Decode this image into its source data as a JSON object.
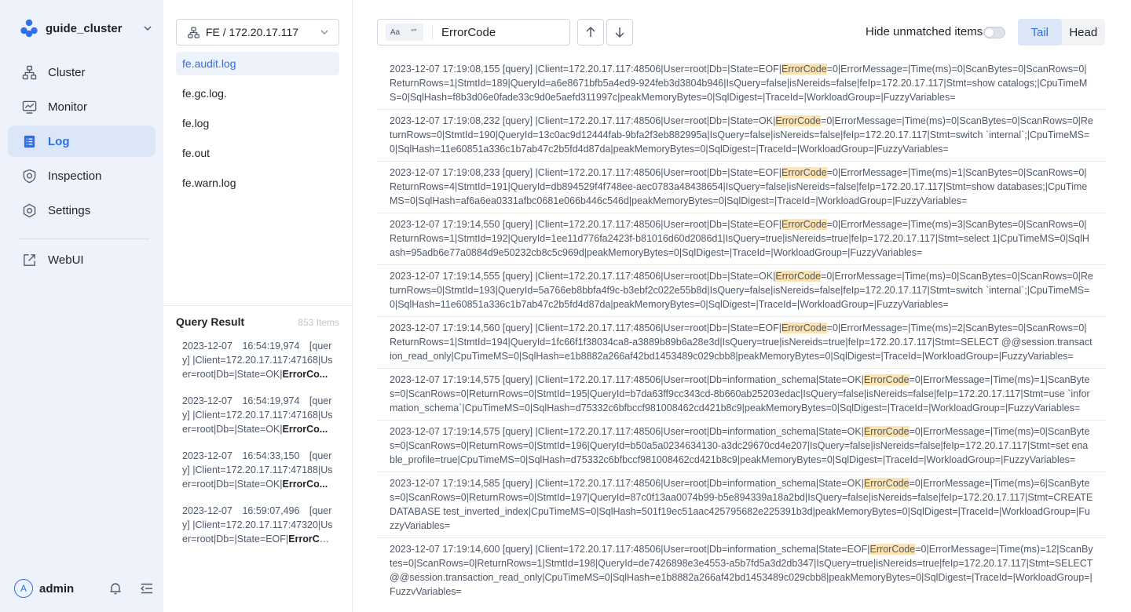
{
  "cluster": {
    "name": "guide_cluster"
  },
  "nav": {
    "items": [
      {
        "label": "Cluster",
        "icon": "cluster-icon"
      },
      {
        "label": "Monitor",
        "icon": "monitor-icon"
      },
      {
        "label": "Log",
        "icon": "log-icon",
        "active": true
      },
      {
        "label": "Inspection",
        "icon": "inspection-icon"
      },
      {
        "label": "Settings",
        "icon": "settings-icon"
      }
    ],
    "webui": {
      "label": "WebUI",
      "icon": "external-link-icon"
    }
  },
  "user": {
    "initial": "A",
    "name": "admin"
  },
  "node_select": {
    "value": "FE / 172.20.17.117"
  },
  "files": [
    {
      "name": "fe.audit.log",
      "active": true
    },
    {
      "name": "fe.gc.log."
    },
    {
      "name": "fe.log"
    },
    {
      "name": "fe.out"
    },
    {
      "name": "fe.warn.log"
    }
  ],
  "query_result": {
    "title": "Query Result",
    "count": "853 Items",
    "items": [
      {
        "l1": "2023-12-07　16:54:19,974　[quer",
        "l2": "y] |Client=172.20.17.117:47168|Us",
        "l3_pre": "er=root|Db=|State=OK|",
        "l3_match": "ErrorCo..."
      },
      {
        "l1": "2023-12-07　16:54:19,974　[quer",
        "l2": "y] |Client=172.20.17.117:47168|Us",
        "l3_pre": "er=root|Db=|State=OK|",
        "l3_match": "ErrorCo..."
      },
      {
        "l1": "2023-12-07　16:54:33,150　[quer",
        "l2": "y] |Client=172.20.17.117:47188|Us",
        "l3_pre": "er=root|Db=|State=OK|",
        "l3_match": "ErrorCo..."
      },
      {
        "l1": "2023-12-07　16:59:07,496　[quer",
        "l2": "y] |Client=172.20.17.117:47320|Us",
        "l3_pre": "er=root|Db=|State=EOF|",
        "l3_match": "ErrorCo..."
      }
    ]
  },
  "search": {
    "value": "ErrorCode",
    "match_case_label": "Aa",
    "whole_word_label": "“”"
  },
  "hide_unmatched": {
    "label": "Hide unmatched items",
    "on": false
  },
  "mode": {
    "tail": "Tail",
    "head": "Head",
    "active": "Tail"
  },
  "log_entries": [
    {
      "pre": "2023-12-07 17:19:08,155 [query] |Client=172.20.17.117:48506|User=root|Db=|State=EOF|",
      "match": "ErrorCode",
      "post": "=0|ErrorMessage=|Time(ms)=0|ScanBytes=0|ScanRows=0|ReturnRows=1|StmtId=189|QueryId=a6e8671bfb5a4ed9-924feb3d3804b946|IsQuery=false|isNereids=false|feIp=172.20.17.117|Stmt=show catalogs;|CpuTimeMS=0|SqlHash=f8b3d06e0fade33c9d0e5aefd311997c|peakMemoryBytes=0|SqlDigest=|TraceId=|WorkloadGroup=|FuzzyVariables="
    },
    {
      "pre": "2023-12-07 17:19:08,232 [query] |Client=172.20.17.117:48506|User=root|Db=|State=OK|",
      "match": "ErrorCode",
      "post": "=0|ErrorMessage=|Time(ms)=0|ScanBytes=0|ScanRows=0|ReturnRows=0|StmtId=190|QueryId=13c0ac9d12444fab-9bfa2f3eb882995a|IsQuery=false|isNereids=false|feIp=172.20.17.117|Stmt=switch `internal`;|CpuTimeMS=0|SqlHash=11e60851a336c1b7ab47c2b5fd4d87da|peakMemoryBytes=0|SqlDigest=|TraceId=|WorkloadGroup=|FuzzyVariables="
    },
    {
      "pre": "2023-12-07 17:19:08,233 [query] |Client=172.20.17.117:48506|User=root|Db=|State=EOF|",
      "match": "ErrorCode",
      "post": "=0|ErrorMessage=|Time(ms)=1|ScanBytes=0|ScanRows=0|ReturnRows=4|StmtId=191|QueryId=db894529f4f748ee-aec0783a48438654|IsQuery=false|isNereids=false|feIp=172.20.17.117|Stmt=show databases;|CpuTimeMS=0|SqlHash=af6a6ea0331afbc0681e066b446c546d|peakMemoryBytes=0|SqlDigest=|TraceId=|WorkloadGroup=|FuzzyVariables="
    },
    {
      "pre": "2023-12-07 17:19:14,550 [query] |Client=172.20.17.117:48506|User=root|Db=|State=EOF|",
      "match": "ErrorCode",
      "post": "=0|ErrorMessage=|Time(ms)=3|ScanBytes=0|ScanRows=0|ReturnRows=1|StmtId=192|QueryId=1ee11d776fa2423f-b81016d60d2086d1|IsQuery=true|isNereids=true|feIp=172.20.17.117|Stmt=select 1|CpuTimeMS=0|SqlHash=95adb6e77a0884d9e50232cb8c5c969d|peakMemoryBytes=0|SqlDigest=|TraceId=|WorkloadGroup=|FuzzyVariables="
    },
    {
      "pre": "2023-12-07 17:19:14,555 [query] |Client=172.20.17.117:48506|User=root|Db=|State=OK|",
      "match": "ErrorCode",
      "post": "=0|ErrorMessage=|Time(ms)=0|ScanBytes=0|ScanRows=0|ReturnRows=0|StmtId=193|QueryId=5a766eb8bbfa4f9c-b3ebf2c022e55b8d|IsQuery=false|isNereids=false|feIp=172.20.17.117|Stmt=switch `internal`;|CpuTimeMS=0|SqlHash=11e60851a336c1b7ab47c2b5fd4d87da|peakMemoryBytes=0|SqlDigest=|TraceId=|WorkloadGroup=|FuzzyVariables="
    },
    {
      "pre": "2023-12-07 17:19:14,560 [query] |Client=172.20.17.117:48506|User=root|Db=|State=EOF|",
      "match": "ErrorCode",
      "post": "=0|ErrorMessage=|Time(ms)=2|ScanBytes=0|ScanRows=0|ReturnRows=1|StmtId=194|QueryId=1fc66f1f38034ca8-a3889b89b6a28e3d|IsQuery=true|isNereids=true|feIp=172.20.17.117|Stmt=SELECT @@session.transaction_read_only|CpuTimeMS=0|SqlHash=e1b8882a266af42bd1453489c029cbb8|peakMemoryBytes=0|SqlDigest=|TraceId=|WorkloadGroup=|FuzzyVariables="
    },
    {
      "pre": "2023-12-07 17:19:14,575 [query] |Client=172.20.17.117:48506|User=root|Db=information_schema|State=OK|",
      "match": "ErrorCode",
      "post": "=0|ErrorMessage=|Time(ms)=1|ScanBytes=0|ScanRows=0|ReturnRows=0|StmtId=195|QueryId=b7da63ff9cc343cd-8b660ab25203edac|IsQuery=false|isNereids=false|feIp=172.20.17.117|Stmt=use `information_schema`|CpuTimeMS=0|SqlHash=d75332c6bfbccf981008462cd421b8c9|peakMemoryBytes=0|SqlDigest=|TraceId=|WorkloadGroup=|FuzzyVariables="
    },
    {
      "pre": "2023-12-07 17:19:14,575 [query] |Client=172.20.17.117:48506|User=root|Db=information_schema|State=OK|",
      "match": "ErrorCode",
      "post": "=0|ErrorMessage=|Time(ms)=0|ScanBytes=0|ScanRows=0|ReturnRows=0|StmtId=196|QueryId=b50a5a0234634130-a3dc29670cd4e207|IsQuery=false|isNereids=false|feIp=172.20.17.117|Stmt=set enable_profile=true|CpuTimeMS=0|SqlHash=d75332c6bfbccf981008462cd421b8c9|peakMemoryBytes=0|SqlDigest=|TraceId=|WorkloadGroup=|FuzzyVariables="
    },
    {
      "pre": "2023-12-07 17:19:14,585 [query] |Client=172.20.17.117:48506|User=root|Db=information_schema|State=OK|",
      "match": "ErrorCode",
      "post": "=0|ErrorMessage=|Time(ms)=6|ScanBytes=0|ScanRows=0|ReturnRows=0|StmtId=197|QueryId=87c0f13aa0074b99-b5e894339a18a2bd|IsQuery=false|isNereids=false|feIp=172.20.17.117|Stmt=CREATE DATABASE test_inverted_index|CpuTimeMS=0|SqlHash=501f19ec51aac425795682e225391b3d|peakMemoryBytes=0|SqlDigest=|TraceId=|WorkloadGroup=|FuzzyVariables="
    },
    {
      "pre": "2023-12-07 17:19:14,600 [query] |Client=172.20.17.117:48506|User=root|Db=information_schema|State=EOF|",
      "match": "ErrorCode",
      "post": "=0|ErrorMessage=|Time(ms)=12|ScanBytes=0|ScanRows=0|ReturnRows=1|StmtId=198|QueryId=de7426898e3e4553-a5b7fd5a3d2db347|IsQuery=true|isNereids=true|feIp=172.20.17.117|Stmt=SELECT @@session.transaction_read_only|CpuTimeMS=0|SqlHash=e1b8882a266af42bd1453489c029cbb8|peakMemoryBytes=0|SqlDigest=|TraceId=|WorkloadGroup=|FuzzyVariables="
    }
  ],
  "colors": {
    "accent": "#2f6fe8",
    "nav_bg": "#edf2fb",
    "highlight": "#fde3b2"
  }
}
